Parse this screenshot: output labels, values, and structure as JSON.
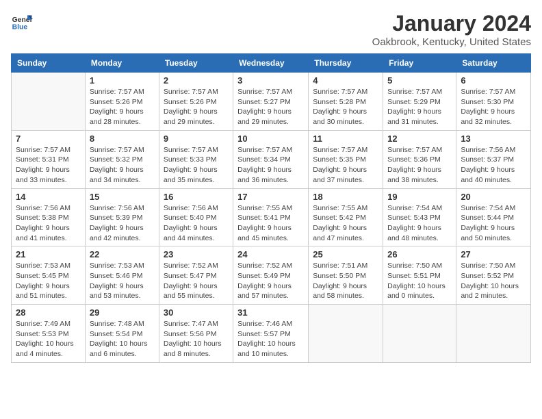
{
  "logo": {
    "text_general": "General",
    "text_blue": "Blue"
  },
  "title": "January 2024",
  "subtitle": "Oakbrook, Kentucky, United States",
  "days_of_week": [
    "Sunday",
    "Monday",
    "Tuesday",
    "Wednesday",
    "Thursday",
    "Friday",
    "Saturday"
  ],
  "weeks": [
    [
      {
        "day": "",
        "info": ""
      },
      {
        "day": "1",
        "info": "Sunrise: 7:57 AM\nSunset: 5:26 PM\nDaylight: 9 hours\nand 28 minutes."
      },
      {
        "day": "2",
        "info": "Sunrise: 7:57 AM\nSunset: 5:26 PM\nDaylight: 9 hours\nand 29 minutes."
      },
      {
        "day": "3",
        "info": "Sunrise: 7:57 AM\nSunset: 5:27 PM\nDaylight: 9 hours\nand 29 minutes."
      },
      {
        "day": "4",
        "info": "Sunrise: 7:57 AM\nSunset: 5:28 PM\nDaylight: 9 hours\nand 30 minutes."
      },
      {
        "day": "5",
        "info": "Sunrise: 7:57 AM\nSunset: 5:29 PM\nDaylight: 9 hours\nand 31 minutes."
      },
      {
        "day": "6",
        "info": "Sunrise: 7:57 AM\nSunset: 5:30 PM\nDaylight: 9 hours\nand 32 minutes."
      }
    ],
    [
      {
        "day": "7",
        "info": "Sunrise: 7:57 AM\nSunset: 5:31 PM\nDaylight: 9 hours\nand 33 minutes."
      },
      {
        "day": "8",
        "info": "Sunrise: 7:57 AM\nSunset: 5:32 PM\nDaylight: 9 hours\nand 34 minutes."
      },
      {
        "day": "9",
        "info": "Sunrise: 7:57 AM\nSunset: 5:33 PM\nDaylight: 9 hours\nand 35 minutes."
      },
      {
        "day": "10",
        "info": "Sunrise: 7:57 AM\nSunset: 5:34 PM\nDaylight: 9 hours\nand 36 minutes."
      },
      {
        "day": "11",
        "info": "Sunrise: 7:57 AM\nSunset: 5:35 PM\nDaylight: 9 hours\nand 37 minutes."
      },
      {
        "day": "12",
        "info": "Sunrise: 7:57 AM\nSunset: 5:36 PM\nDaylight: 9 hours\nand 38 minutes."
      },
      {
        "day": "13",
        "info": "Sunrise: 7:56 AM\nSunset: 5:37 PM\nDaylight: 9 hours\nand 40 minutes."
      }
    ],
    [
      {
        "day": "14",
        "info": "Sunrise: 7:56 AM\nSunset: 5:38 PM\nDaylight: 9 hours\nand 41 minutes."
      },
      {
        "day": "15",
        "info": "Sunrise: 7:56 AM\nSunset: 5:39 PM\nDaylight: 9 hours\nand 42 minutes."
      },
      {
        "day": "16",
        "info": "Sunrise: 7:56 AM\nSunset: 5:40 PM\nDaylight: 9 hours\nand 44 minutes."
      },
      {
        "day": "17",
        "info": "Sunrise: 7:55 AM\nSunset: 5:41 PM\nDaylight: 9 hours\nand 45 minutes."
      },
      {
        "day": "18",
        "info": "Sunrise: 7:55 AM\nSunset: 5:42 PM\nDaylight: 9 hours\nand 47 minutes."
      },
      {
        "day": "19",
        "info": "Sunrise: 7:54 AM\nSunset: 5:43 PM\nDaylight: 9 hours\nand 48 minutes."
      },
      {
        "day": "20",
        "info": "Sunrise: 7:54 AM\nSunset: 5:44 PM\nDaylight: 9 hours\nand 50 minutes."
      }
    ],
    [
      {
        "day": "21",
        "info": "Sunrise: 7:53 AM\nSunset: 5:45 PM\nDaylight: 9 hours\nand 51 minutes."
      },
      {
        "day": "22",
        "info": "Sunrise: 7:53 AM\nSunset: 5:46 PM\nDaylight: 9 hours\nand 53 minutes."
      },
      {
        "day": "23",
        "info": "Sunrise: 7:52 AM\nSunset: 5:47 PM\nDaylight: 9 hours\nand 55 minutes."
      },
      {
        "day": "24",
        "info": "Sunrise: 7:52 AM\nSunset: 5:49 PM\nDaylight: 9 hours\nand 57 minutes."
      },
      {
        "day": "25",
        "info": "Sunrise: 7:51 AM\nSunset: 5:50 PM\nDaylight: 9 hours\nand 58 minutes."
      },
      {
        "day": "26",
        "info": "Sunrise: 7:50 AM\nSunset: 5:51 PM\nDaylight: 10 hours\nand 0 minutes."
      },
      {
        "day": "27",
        "info": "Sunrise: 7:50 AM\nSunset: 5:52 PM\nDaylight: 10 hours\nand 2 minutes."
      }
    ],
    [
      {
        "day": "28",
        "info": "Sunrise: 7:49 AM\nSunset: 5:53 PM\nDaylight: 10 hours\nand 4 minutes."
      },
      {
        "day": "29",
        "info": "Sunrise: 7:48 AM\nSunset: 5:54 PM\nDaylight: 10 hours\nand 6 minutes."
      },
      {
        "day": "30",
        "info": "Sunrise: 7:47 AM\nSunset: 5:56 PM\nDaylight: 10 hours\nand 8 minutes."
      },
      {
        "day": "31",
        "info": "Sunrise: 7:46 AM\nSunset: 5:57 PM\nDaylight: 10 hours\nand 10 minutes."
      },
      {
        "day": "",
        "info": ""
      },
      {
        "day": "",
        "info": ""
      },
      {
        "day": "",
        "info": ""
      }
    ]
  ]
}
